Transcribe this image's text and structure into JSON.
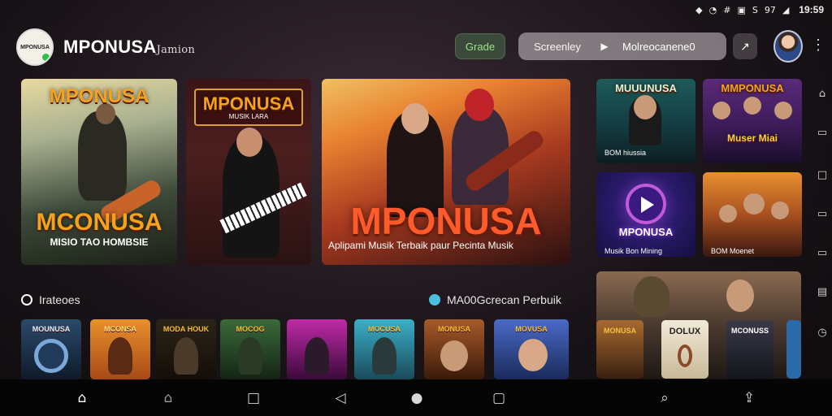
{
  "status_bar": {
    "icons": [
      "shield-icon",
      "wifi-icon",
      "hashtag-icon",
      "alarm-icon",
      "data-icon",
      "signal-icon"
    ],
    "time": "19:59",
    "percent": "97"
  },
  "header": {
    "app_name": "MPONUSA",
    "app_subtitle": "Jamion",
    "grade_label": "Grade",
    "player_left": "Screenley",
    "player_right": "Molreocanene0",
    "logo_text": "MPONUSA"
  },
  "featured": {
    "big1": {
      "title": "MCONUSA",
      "subtitle": "MISIO TAO HOMBSIE",
      "top_title": "MPONUSA"
    },
    "big2": {
      "title": "MPONUSA",
      "subtitle": "MUSIK LARA"
    },
    "hero": {
      "title": "MPONUSA",
      "subtitle": "Aplipami Musik Terbaik paur Pecinta Musik"
    }
  },
  "side_tiles": [
    {
      "title": "MUUUNUSA",
      "caption": "BOM hiussia"
    },
    {
      "title": "MMPONUSA",
      "caption": "Muser Miai"
    },
    {
      "title": "MPONUSA",
      "caption": "Musik Bon Mining"
    },
    {
      "title": "",
      "caption": "BOM Moenet"
    }
  ],
  "wide_tile": {
    "subs": [
      "MONUSA",
      "DOLUX",
      "MCONUSS",
      ""
    ]
  },
  "sections": {
    "left": "Irateoes",
    "right": "MA00Gcrecan Perbuik"
  },
  "row_tiles": [
    {
      "label": "MOUNUSA"
    },
    {
      "label": "MCONSA"
    },
    {
      "label": "MODA HOUK"
    },
    {
      "label": "MOCOG"
    },
    {
      "label": ""
    },
    {
      "label": "MOCUSA"
    },
    {
      "label": "MONUSA"
    },
    {
      "label": "MOVUSA"
    }
  ],
  "nav_icons": [
    "home-icon",
    "home-outline-icon",
    "square-icon",
    "back-icon",
    "circle-icon",
    "recent-icon",
    "search-icon",
    "share-icon"
  ]
}
